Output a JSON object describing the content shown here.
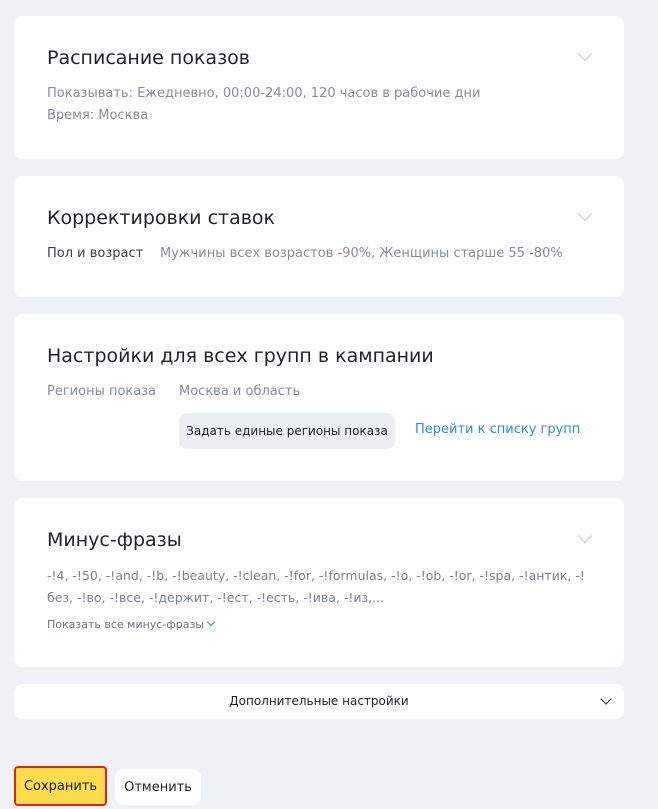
{
  "schedule": {
    "title": "Расписание показов",
    "line1": "Показывать: Ежедневно, 00:00-24:00, 120 часов в рабочие дни",
    "line2": "Время: Москва"
  },
  "bids": {
    "title": "Корректировки ставок",
    "label": "Пол и возраст",
    "value_part1": "Мужчины всех возрастов ",
    "value_neg1": "-",
    "value_part2": "90%, Женщины старше 55 ",
    "value_neg2": "-",
    "value_part3": "80%"
  },
  "group_settings": {
    "title": "Настройки для всех групп в кампании",
    "regions_label": "Регионы показа",
    "regions_value": "Москва и область",
    "set_regions_button": "Задать единые регионы показа",
    "go_to_groups_link": "Перейти к списку групп"
  },
  "minus_phrases": {
    "title": "Минус-фразы",
    "text": "-!4, -!50, -!and, -!b, -!beauty, -!clean, -!for, -!formulas, -!o, -!ob, -!or, -!spa, -!антик, -!без, -!во, -!все, -!держит, -!ест, -!есть, -!ива, -!из,...",
    "show_all": "Показать все минус-фразы"
  },
  "additional": {
    "label": "Дополнительные настройки"
  },
  "actions": {
    "save": "Сохранить",
    "cancel": "Отменить"
  },
  "colors": {
    "accent_yellow": "#ffdb4d",
    "link_blue": "#2f8ae0",
    "negative_red": "#e3412d",
    "background": "#eff1f6"
  }
}
